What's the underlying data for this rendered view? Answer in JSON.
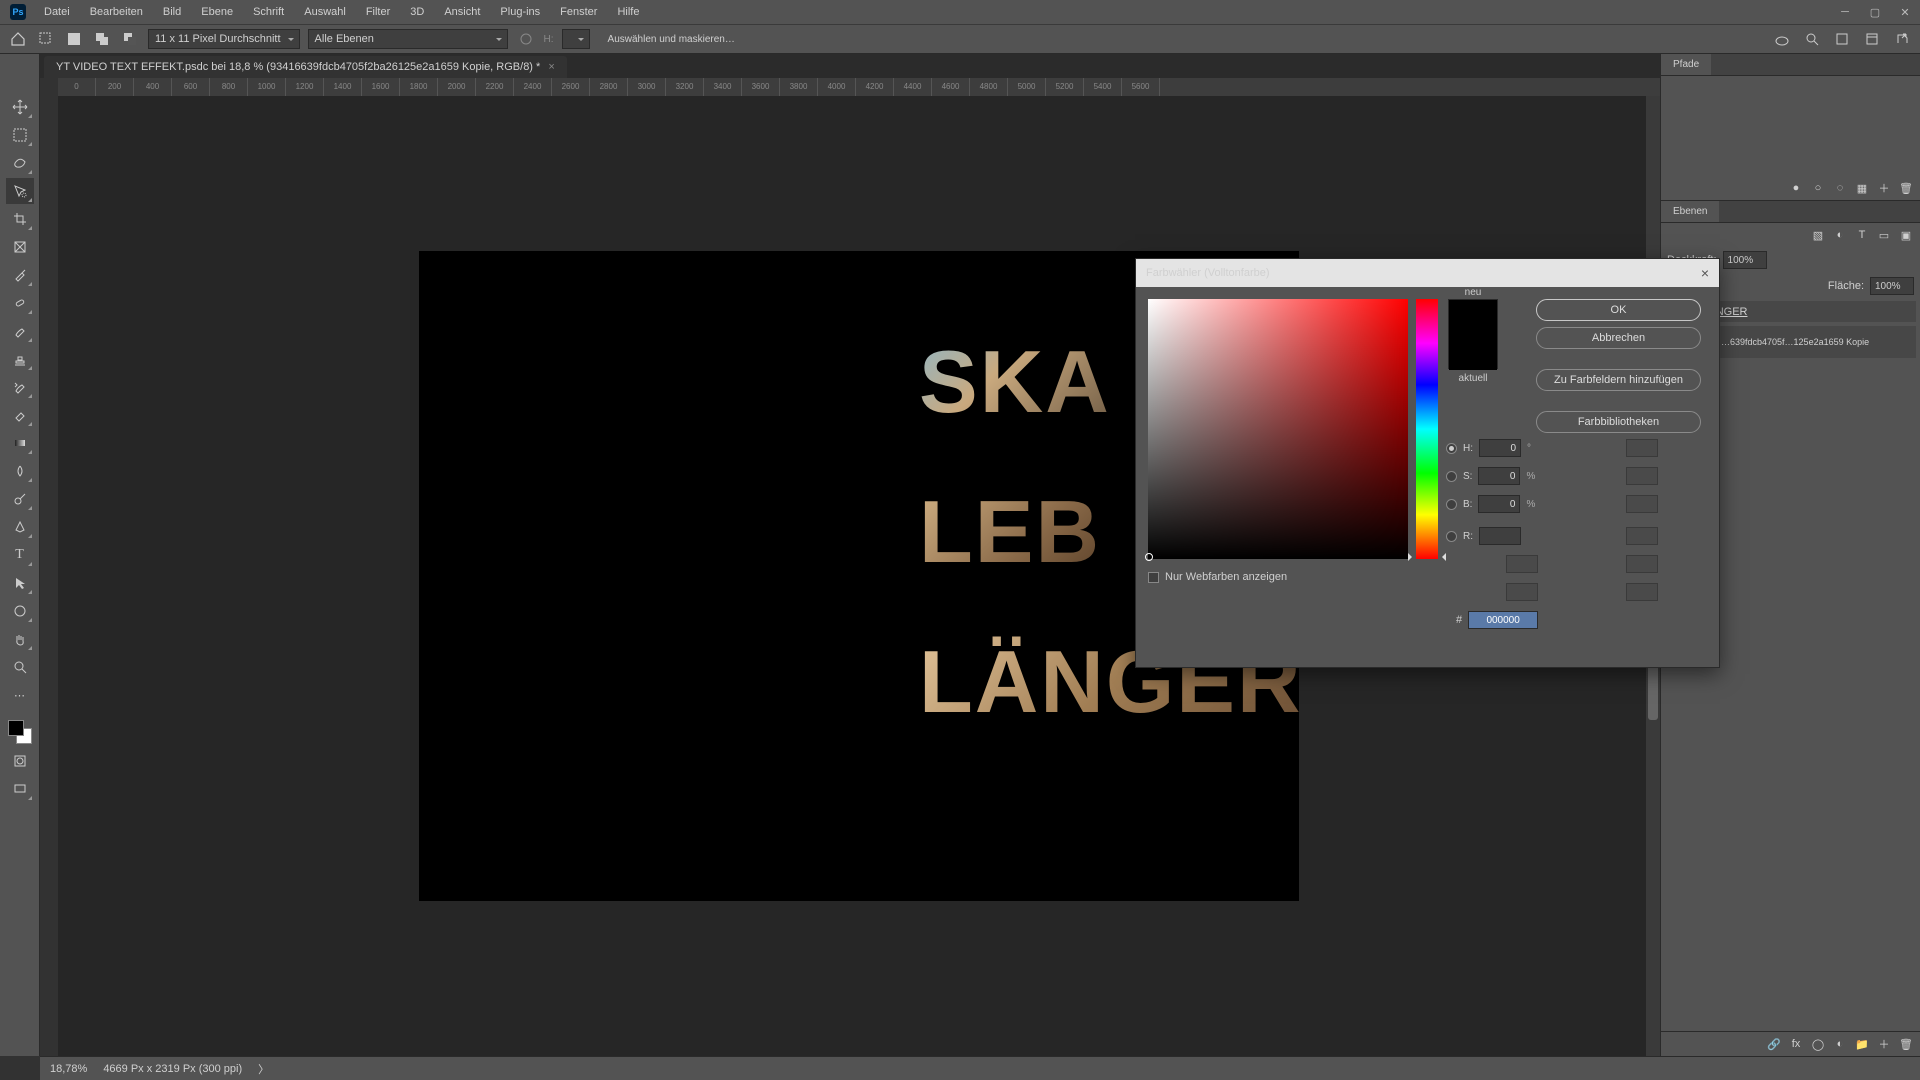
{
  "menu": {
    "items": [
      "Datei",
      "Bearbeiten",
      "Bild",
      "Ebene",
      "Schrift",
      "Auswahl",
      "Filter",
      "3D",
      "Ansicht",
      "Plug-ins",
      "Fenster",
      "Hilfe"
    ]
  },
  "optionsbar": {
    "sample_size": "11 x 11 Pixel Durchschnitt",
    "scope": "Alle Ebenen",
    "select_mask": "Auswählen und maskieren…"
  },
  "document": {
    "tab_title": "YT VIDEO TEXT EFFEKT.psdc bei 18,8 % (93416639fdcb4705f2ba26125e2a1659 Kopie, RGB/8) *"
  },
  "ruler_ticks": [
    "0",
    "200",
    "400",
    "600",
    "800",
    "1000",
    "1200",
    "1400",
    "1600",
    "1800",
    "2000",
    "2200",
    "2400",
    "2600",
    "2800",
    "3000",
    "3200",
    "3400",
    "3600",
    "3800",
    "4000",
    "4200",
    "4400",
    "4600",
    "4800",
    "5000",
    "5200",
    "5400",
    "5600"
  ],
  "canvas_text": {
    "line1": "SKA",
    "line2": "LEB",
    "line3": "LÄNGER"
  },
  "panel": {
    "tab_paths": "Pfade",
    "tab_layers": "Ebenen",
    "opacity_label": "Deckkraft:",
    "opacity_value": "100%",
    "fill_label": "Fläche:",
    "fill_value": "100%",
    "layer_group": "LÄNGER",
    "layer_name": "…639fdcb4705f…125e2a1659 Kopie"
  },
  "status": {
    "zoom": "18,78%",
    "docinfo": "4669 Px x 2319 Px (300 ppi)"
  },
  "dialog": {
    "title": "Farbwähler (Volltonfarbe)",
    "new_label": "neu",
    "current_label": "aktuell",
    "ok": "OK",
    "cancel": "Abbrechen",
    "add_swatch": "Zu Farbfeldern hinzufügen",
    "libs": "Farbbibliotheken",
    "webonly": "Nur Webfarben anzeigen",
    "H_label": "H:",
    "H_value": "0",
    "H_unit": "°",
    "S_label": "S:",
    "S_value": "0",
    "S_unit": "%",
    "B_label": "B:",
    "B_value": "0",
    "B_unit": "%",
    "R_label": "R:",
    "R_value": "",
    "hex": "000000"
  }
}
